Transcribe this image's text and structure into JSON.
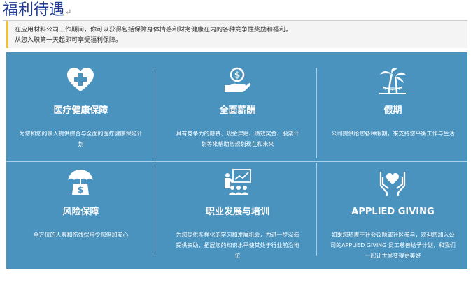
{
  "page": {
    "title": "福利待遇",
    "title_mark": "↵",
    "intro_line1": "在应用材料公司工作期间，你可以获得包括保障身体情感和财务健康在内的各种竞争性奖励和福利。",
    "intro_line2": "从您入职第一天起即可享受福利保障。"
  },
  "colors": {
    "panel": "#4a93bf",
    "accent_bar": "#f2c12e",
    "title": "#1f3a93"
  },
  "benefits": [
    {
      "icon": "heart-plus-icon",
      "title": "医疗健康保障",
      "desc": "为您和您的家人提供综合与全面的医疗健康保险计划"
    },
    {
      "icon": "hand-coin-icon",
      "title": "全面薪酬",
      "desc": "具有竞争力的薪资、现金津贴、绩效奖金、股票计划等来帮助您规划现在和未来"
    },
    {
      "icon": "palm-tree-icon",
      "title": "假期",
      "desc": "公司提供给您各种假期，来支持您平衡工作与生活"
    },
    {
      "icon": "umbrella-money-icon",
      "title": "风险保障",
      "desc": "全方位的人寿和伤残保险令您倍加安心"
    },
    {
      "icon": "presentation-icon",
      "title": "职业发展与培训",
      "desc": "为您提供多样化的学习和发展机会，为进一步深造提供资助，拓展您的知识水平使其处于行业前沿地位"
    },
    {
      "icon": "hands-heart-icon",
      "title": "APPLIED GIVING",
      "desc": "如果您热衷于社会议题或社区参与，欢迎您加入公司的APPLIED GIVING 员工慈善给予计划，和我们一起让世界变得更美好"
    }
  ]
}
